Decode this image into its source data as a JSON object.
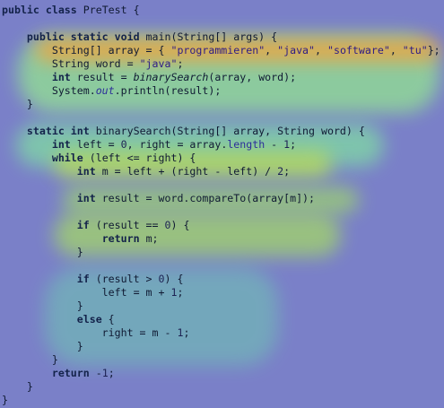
{
  "editor": {
    "colors": {
      "background": "#7a80c8",
      "heat_high": "#f4a23a",
      "heat_mid": "#b7dc59",
      "heat_low": "#6fc7b2"
    },
    "lines": [
      [
        {
          "t": "public class ",
          "c": "kw"
        },
        {
          "t": "PreTest {"
        }
      ],
      [
        {
          "t": ""
        }
      ],
      [
        {
          "t": "    "
        },
        {
          "t": "public static void ",
          "c": "kw"
        },
        {
          "t": "main(String[] args) {"
        }
      ],
      [
        {
          "t": "        String[] array = { "
        },
        {
          "t": "\"programmieren\"",
          "c": "str"
        },
        {
          "t": ", "
        },
        {
          "t": "\"java\"",
          "c": "str"
        },
        {
          "t": ", "
        },
        {
          "t": "\"software\"",
          "c": "str"
        },
        {
          "t": ", "
        },
        {
          "t": "\"tu\"",
          "c": "str"
        },
        {
          "t": "};"
        }
      ],
      [
        {
          "t": "        String word = "
        },
        {
          "t": "\"java\"",
          "c": "str"
        },
        {
          "t": ";"
        }
      ],
      [
        {
          "t": "        "
        },
        {
          "t": "int ",
          "c": "kw"
        },
        {
          "t": "result = "
        },
        {
          "t": "binarySearch",
          "c": "it"
        },
        {
          "t": "(array, word);"
        }
      ],
      [
        {
          "t": "        System."
        },
        {
          "t": "out",
          "c": "fld it"
        },
        {
          "t": ".println(result);"
        }
      ],
      [
        {
          "t": "    }"
        }
      ],
      [
        {
          "t": ""
        }
      ],
      [
        {
          "t": "    "
        },
        {
          "t": "static int ",
          "c": "kw"
        },
        {
          "t": "binarySearch(String[] array, String word) {"
        }
      ],
      [
        {
          "t": "        "
        },
        {
          "t": "int ",
          "c": "kw"
        },
        {
          "t": "left = "
        },
        {
          "t": "0",
          "c": "num"
        },
        {
          "t": ", right = array."
        },
        {
          "t": "length",
          "c": "fld"
        },
        {
          "t": " - "
        },
        {
          "t": "1",
          "c": "num"
        },
        {
          "t": ";"
        }
      ],
      [
        {
          "t": "        "
        },
        {
          "t": "while ",
          "c": "kw"
        },
        {
          "t": "(left <= right) {"
        }
      ],
      [
        {
          "t": "            "
        },
        {
          "t": "int ",
          "c": "kw"
        },
        {
          "t": "m = left + (right - left) / "
        },
        {
          "t": "2",
          "c": "num"
        },
        {
          "t": ";"
        }
      ],
      [
        {
          "t": ""
        }
      ],
      [
        {
          "t": "            "
        },
        {
          "t": "int ",
          "c": "kw"
        },
        {
          "t": "result = word.compareTo(array[m]);"
        }
      ],
      [
        {
          "t": ""
        }
      ],
      [
        {
          "t": "            "
        },
        {
          "t": "if ",
          "c": "kw"
        },
        {
          "t": "(result == "
        },
        {
          "t": "0",
          "c": "num"
        },
        {
          "t": ") {"
        }
      ],
      [
        {
          "t": "                "
        },
        {
          "t": "return ",
          "c": "kw"
        },
        {
          "t": "m;"
        }
      ],
      [
        {
          "t": "            }"
        }
      ],
      [
        {
          "t": ""
        }
      ],
      [
        {
          "t": "            "
        },
        {
          "t": "if ",
          "c": "kw"
        },
        {
          "t": "(result > "
        },
        {
          "t": "0",
          "c": "num"
        },
        {
          "t": ") {"
        }
      ],
      [
        {
          "t": "                left = m + "
        },
        {
          "t": "1",
          "c": "num"
        },
        {
          "t": ";"
        }
      ],
      [
        {
          "t": "            }"
        }
      ],
      [
        {
          "t": "            "
        },
        {
          "t": "else ",
          "c": "kw"
        },
        {
          "t": "{"
        }
      ],
      [
        {
          "t": "                right = m - "
        },
        {
          "t": "1",
          "c": "num"
        },
        {
          "t": ";"
        }
      ],
      [
        {
          "t": "            }"
        }
      ],
      [
        {
          "t": "        }"
        }
      ],
      [
        {
          "t": "        "
        },
        {
          "t": "return ",
          "c": "kw"
        },
        {
          "t": "-"
        },
        {
          "t": "1",
          "c": "num"
        },
        {
          "t": ";"
        }
      ],
      [
        {
          "t": "    }"
        }
      ],
      [
        {
          "t": "}"
        }
      ]
    ]
  }
}
